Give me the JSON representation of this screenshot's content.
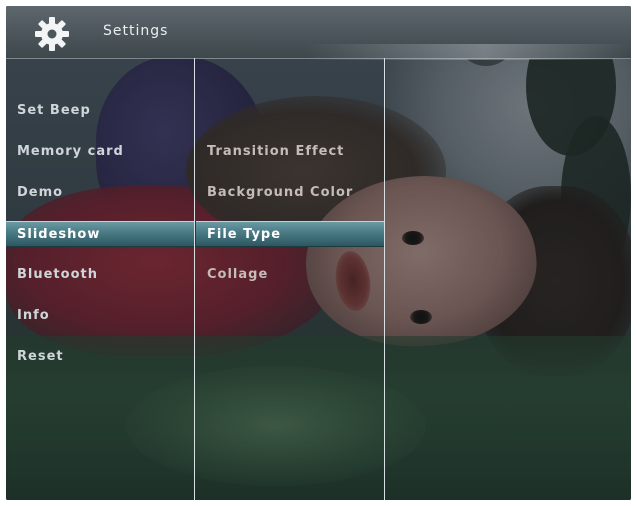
{
  "header": {
    "title": "Settings",
    "icon": "gear-icon"
  },
  "menu": {
    "level1": [
      {
        "label": "Set Beep",
        "selected": false
      },
      {
        "label": "Memory card",
        "selected": false
      },
      {
        "label": "Demo",
        "selected": false
      },
      {
        "label": "Slideshow",
        "selected": true
      },
      {
        "label": "Bluetooth",
        "selected": false
      },
      {
        "label": "Info",
        "selected": false
      },
      {
        "label": "Reset",
        "selected": false
      }
    ],
    "level2": [
      {
        "label": "Transition Effect",
        "selected": false
      },
      {
        "label": "Background Color",
        "selected": false
      },
      {
        "label": "File Type",
        "selected": true
      },
      {
        "label": "Collage",
        "selected": false
      }
    ]
  },
  "colors": {
    "header": "#4b555a",
    "highlight": "#497a84",
    "divider": "#d9e0e3",
    "text": "#cfd6d9"
  }
}
